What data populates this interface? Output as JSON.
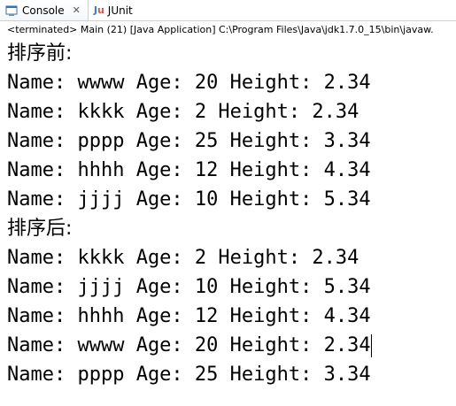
{
  "tabs": [
    {
      "label": "Console",
      "icon": "console-icon",
      "close": "✕"
    },
    {
      "label": "JUnit",
      "icon": "junit-icon"
    }
  ],
  "status": "<terminated> Main (21) [Java Application] C:\\Program Files\\Java\\jdk1.7.0_15\\bin\\javaw.",
  "output": {
    "before_heading": "排序前:",
    "before": [
      "Name: wwww Age: 20 Height: 2.34",
      "Name: kkkk Age: 2 Height: 2.34",
      "Name: pppp Age: 25 Height: 3.34",
      "Name: hhhh Age: 12 Height: 4.34",
      "Name: jjjj Age: 10 Height: 5.34"
    ],
    "after_heading": "排序后:",
    "after": [
      "Name: kkkk Age: 2 Height: 2.34",
      "Name: jjjj Age: 10 Height: 5.34",
      "Name: hhhh Age: 12 Height: 4.34",
      "Name: wwww Age: 20 Height: 2.34",
      "Name: pppp Age: 25 Height: 3.34"
    ]
  },
  "colors": {
    "tab_border": "#c9d3e0",
    "junit_blue": "#3a7bd5",
    "junit_red": "#d9534f"
  }
}
